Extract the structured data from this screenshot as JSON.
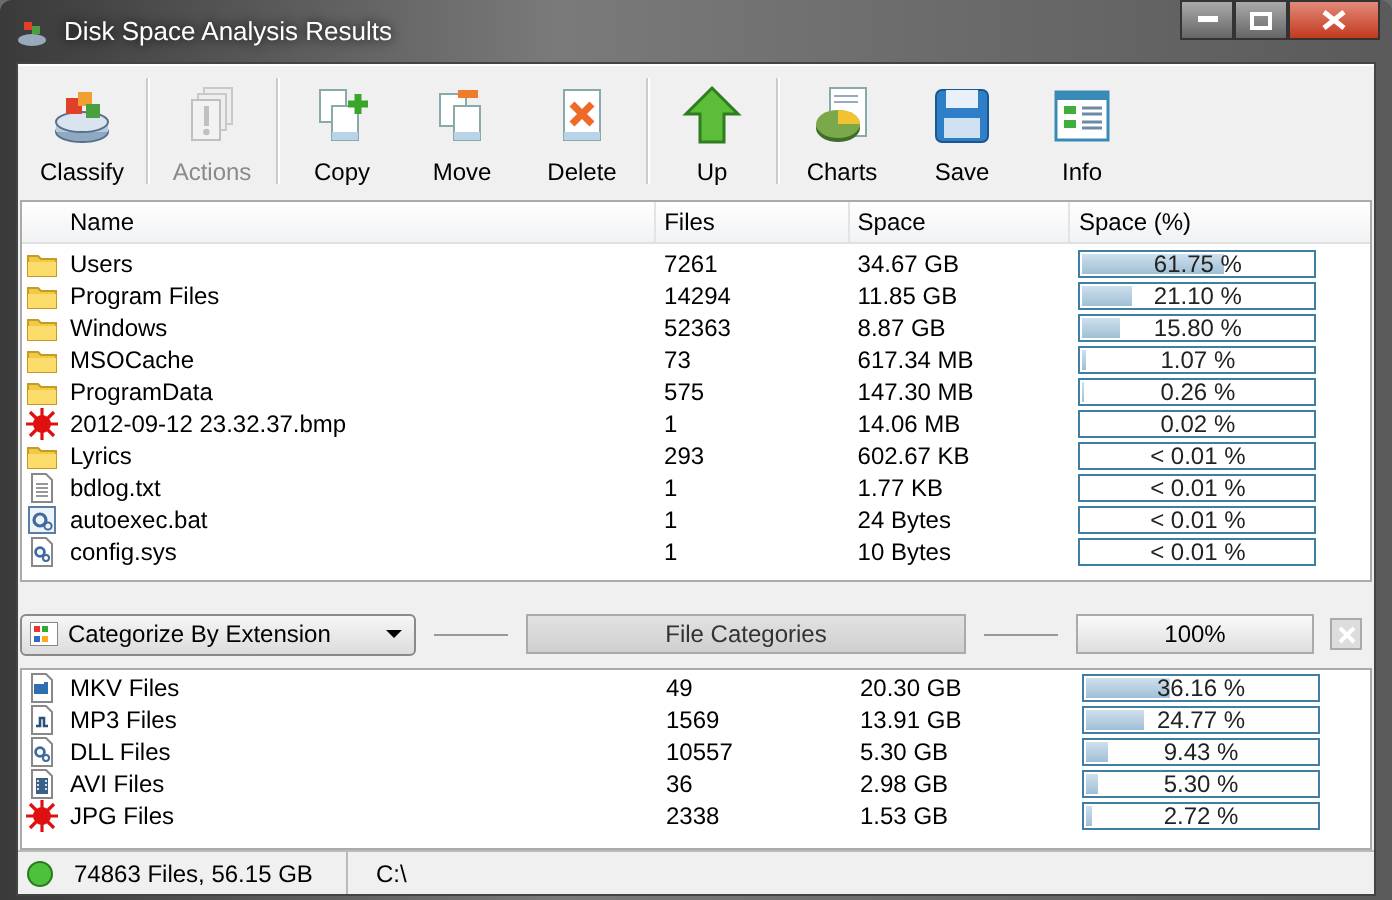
{
  "window": {
    "title": "Disk Space Analysis Results"
  },
  "toolbar": [
    {
      "label": "Classify",
      "kind": "classify",
      "disabled": false
    },
    {
      "label": "Actions",
      "kind": "actions",
      "disabled": true
    },
    {
      "label": "Copy",
      "kind": "copy",
      "disabled": false
    },
    {
      "label": "Move",
      "kind": "move",
      "disabled": false
    },
    {
      "label": "Delete",
      "kind": "delete",
      "disabled": false
    },
    {
      "label": "Up",
      "kind": "up",
      "disabled": false
    },
    {
      "label": "Charts",
      "kind": "charts",
      "disabled": false
    },
    {
      "label": "Save",
      "kind": "save",
      "disabled": false
    },
    {
      "label": "Info",
      "kind": "info",
      "disabled": false
    }
  ],
  "table": {
    "columns": [
      "Name",
      "Files",
      "Space",
      "Space (%)"
    ],
    "rows": [
      {
        "kind": "folder",
        "name": "Users",
        "files": "7261",
        "space": "34.67 GB",
        "percent": "61.75 %",
        "level": 0.6175
      },
      {
        "kind": "folder",
        "name": "Program Files",
        "files": "14294",
        "space": "11.85 GB",
        "percent": "21.10 %",
        "level": 0.211
      },
      {
        "kind": "folder",
        "name": "Windows",
        "files": "52363",
        "space": "8.87 GB",
        "percent": "15.80 %",
        "level": 0.158
      },
      {
        "kind": "folder",
        "name": "MSOCache",
        "files": "73",
        "space": "617.34 MB",
        "percent": "1.07 %",
        "level": 0.0107
      },
      {
        "kind": "folder",
        "name": "ProgramData",
        "files": "575",
        "space": "147.30 MB",
        "percent": "0.26 %",
        "level": 0.0026
      },
      {
        "kind": "image",
        "name": "2012-09-12 23.32.37.bmp",
        "files": "1",
        "space": "14.06 MB",
        "percent": "0.02 %",
        "level": 0.0002
      },
      {
        "kind": "folder",
        "name": "Lyrics",
        "files": "293",
        "space": "602.67 KB",
        "percent": "< 0.01 %",
        "level": 0
      },
      {
        "kind": "text",
        "name": "bdlog.txt",
        "files": "1",
        "space": "1.77 KB",
        "percent": "< 0.01 %",
        "level": 0
      },
      {
        "kind": "script",
        "name": "autoexec.bat",
        "files": "1",
        "space": "24 Bytes",
        "percent": "< 0.01 %",
        "level": 0
      },
      {
        "kind": "system",
        "name": "config.sys",
        "files": "1",
        "space": "10 Bytes",
        "percent": "< 0.01 %",
        "level": 0
      }
    ]
  },
  "category_bar": {
    "dropdown": "Categorize By Extension",
    "title": "File Categories",
    "total": "100%"
  },
  "categories": [
    {
      "kind": "video",
      "name": "MKV Files",
      "files": "49",
      "space": "20.30 GB",
      "percent": "36.16 %",
      "level": 0.3616
    },
    {
      "kind": "audio",
      "name": "MP3 Files",
      "files": "1569",
      "space": "13.91 GB",
      "percent": "24.77 %",
      "level": 0.2477
    },
    {
      "kind": "system",
      "name": "DLL Files",
      "files": "10557",
      "space": "5.30 GB",
      "percent": "9.43 %",
      "level": 0.0943
    },
    {
      "kind": "film",
      "name": "AVI Files",
      "files": "36",
      "space": "2.98 GB",
      "percent": "5.30 %",
      "level": 0.053
    },
    {
      "kind": "image",
      "name": "JPG Files",
      "files": "2338",
      "space": "1.53 GB",
      "percent": "2.72 %",
      "level": 0.0272
    }
  ],
  "status_bar": {
    "summary": "74863 Files, 56.15 GB",
    "path": "C:\\"
  }
}
